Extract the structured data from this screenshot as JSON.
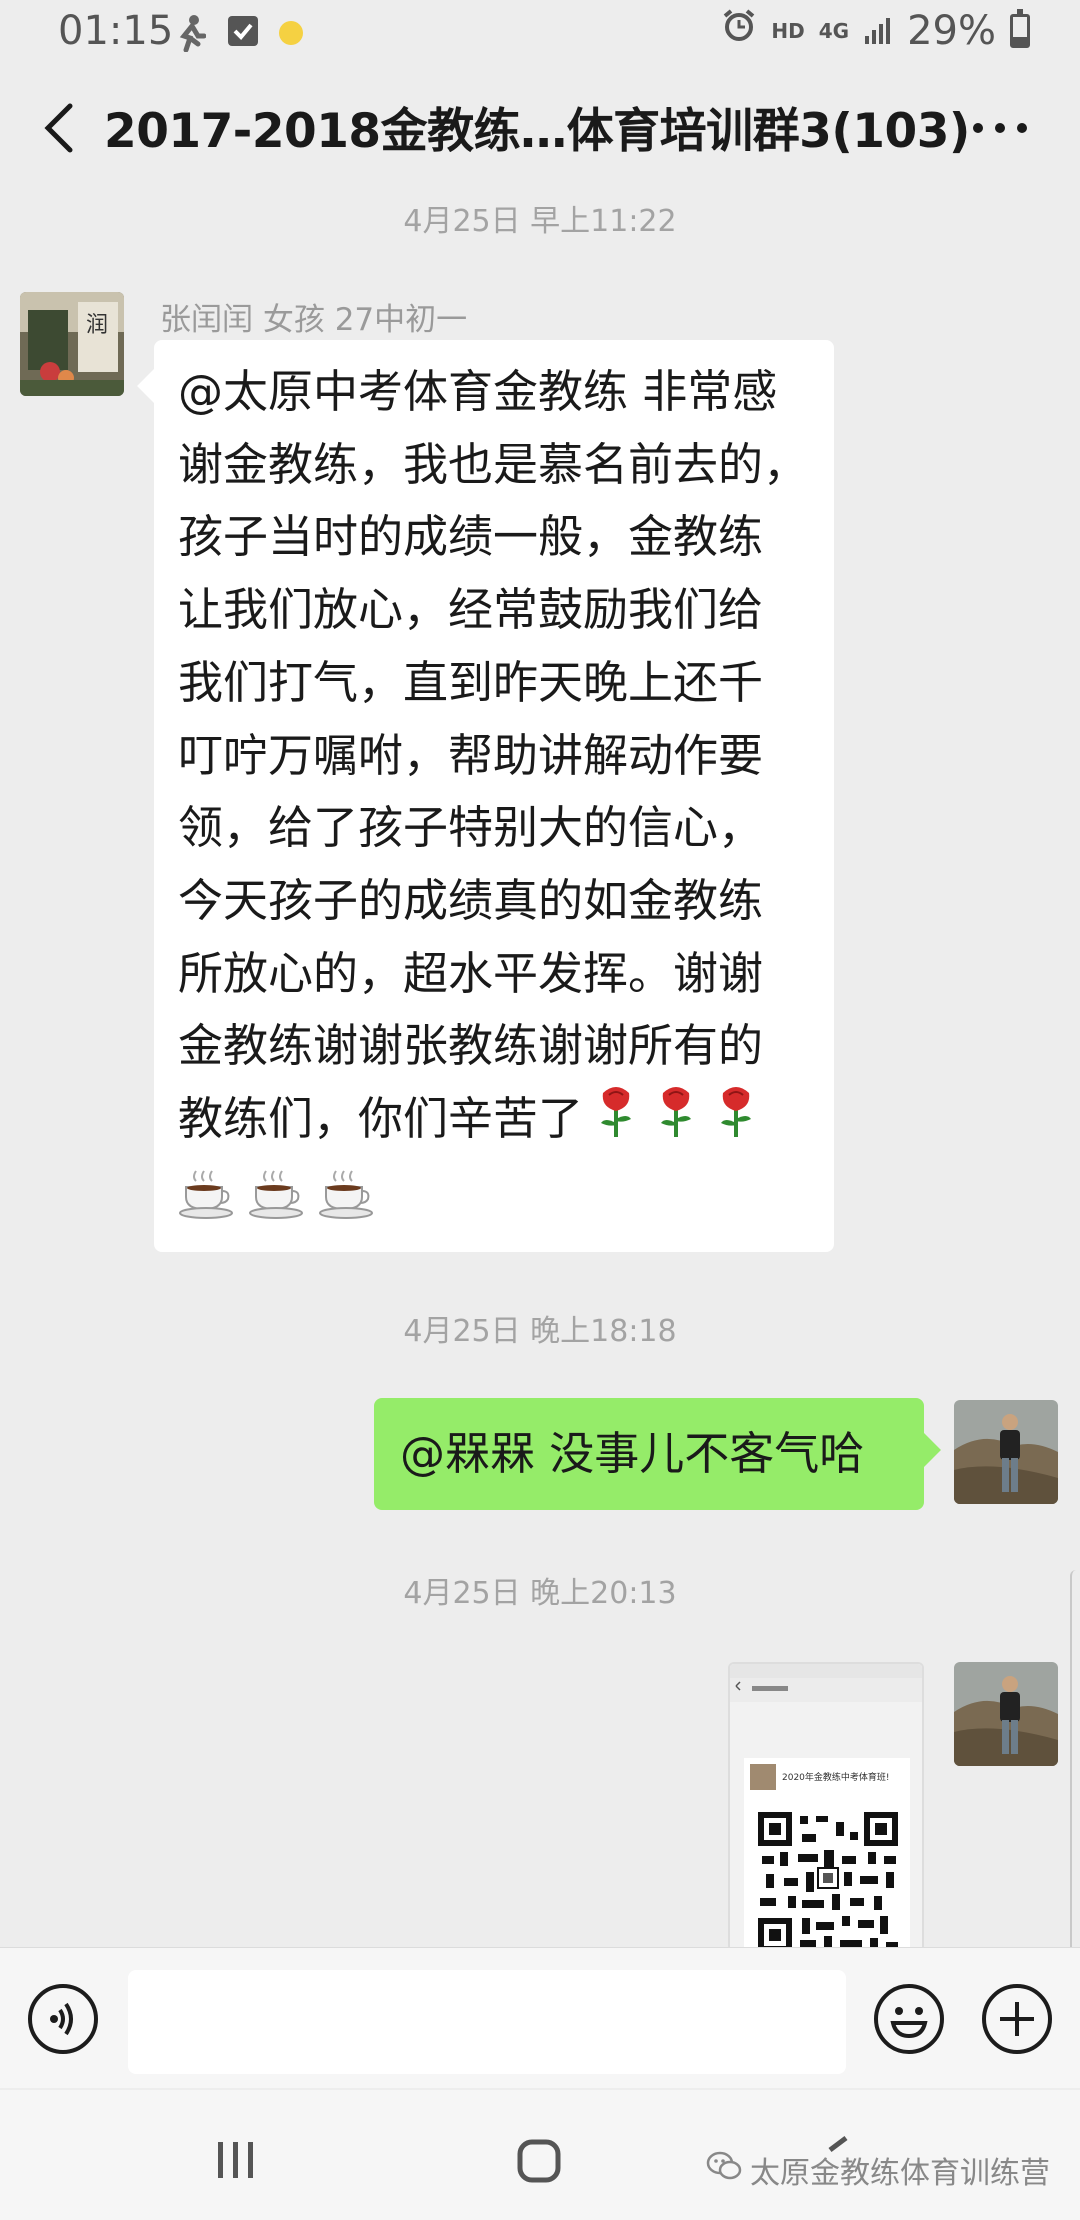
{
  "status_bar": {
    "time": "01:15",
    "battery": "29%",
    "battery_level": 0.29,
    "network": "4G",
    "hd": "HD"
  },
  "header": {
    "title": "2017-2018金教练…体育培训群3(103)"
  },
  "messages": [
    {
      "type": "timestamp",
      "text": "4月25日 早上11:22"
    },
    {
      "type": "incoming_text",
      "sender": "张闰闰  女孩  27中初一",
      "text": "@太原中考体育金教练  非常感\n谢金教练，我也是慕名前去的，\n孩子当时的成绩一般，金教练\n让我们放心，经常鼓励我们给\n我们打气，直到昨天晚上还千\n叮咛万嘱咐，帮助讲解动作要\n领，给了孩子特别大的信心，\n今天孩子的成绩真的如金教练\n所放心的，超水平发挥。谢谢\n金教练谢谢张教练谢谢所有的\n教练们，你们辛苦了",
      "emoji": [
        "rose",
        "rose",
        "rose",
        "coffee",
        "coffee",
        "coffee"
      ]
    },
    {
      "type": "timestamp",
      "text": "4月25日 晚上18:18"
    },
    {
      "type": "outgoing_text",
      "text": "@槑槑  没事儿不客气哈"
    },
    {
      "type": "timestamp",
      "text": "4月25日 晚上20:13"
    },
    {
      "type": "outgoing_image",
      "image_caption": "2020年金教练中考体育班!"
    }
  ],
  "input_bar": {
    "voice_icon": "voice-icon",
    "emoji_icon": "emoji-icon",
    "plus_icon": "plus-icon",
    "text": ""
  },
  "watermark": "太原金教练体育训练营",
  "colors": {
    "background": "#ededed",
    "outgoing_bubble": "#95ec69",
    "incoming_bubble": "#ffffff"
  }
}
